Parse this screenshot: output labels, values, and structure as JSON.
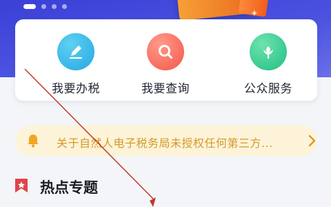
{
  "banner": {
    "slides": 4,
    "active_slide": 1
  },
  "services": [
    {
      "label": "我要办税",
      "icon": "pen-icon",
      "color": "#25a8e3"
    },
    {
      "label": "我要查询",
      "icon": "search-icon",
      "color": "#f4574a"
    },
    {
      "label": "公众服务",
      "icon": "flower-icon",
      "color": "#1fbf80"
    }
  ],
  "notice": {
    "text": "关于自然人电子税务局未授权任何第三方...",
    "icon": "bell-icon",
    "color": "#d49a2a"
  },
  "section": {
    "title": "热点专题",
    "icon": "bookmark-icon",
    "color": "#e0434b"
  },
  "colors": {
    "hero": "#3b40d6",
    "annotation_arrow": "#c0392b"
  }
}
